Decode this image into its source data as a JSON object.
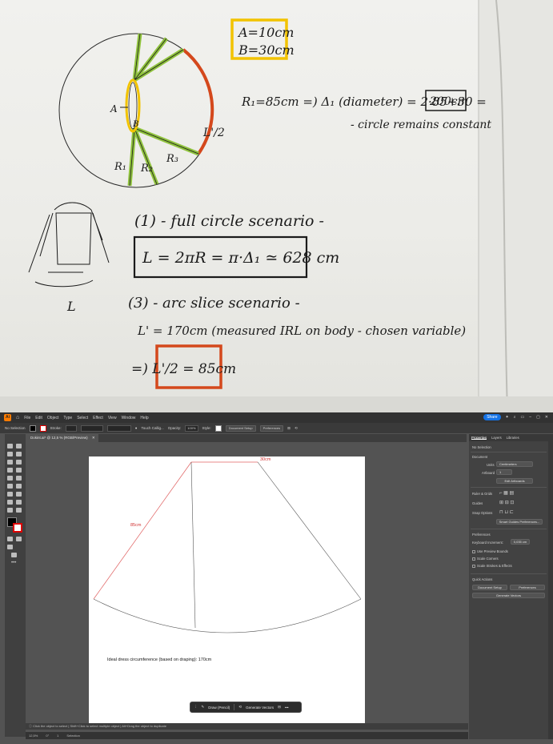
{
  "whiteboard": {
    "a_label": "A=10cm",
    "b_label": "B=30cm",
    "diagram_labels": {
      "a": "A",
      "b": "B",
      "r1": "R₁",
      "r2": "R₂",
      "r3": "R₃",
      "l_prime_half": "L'/2"
    },
    "line1": "R₁=85cm =) Δ₁ (diameter) = 2·85+30 = ",
    "boxed_value": "200cm",
    "line2": "- circle remains constant",
    "sketch_label": "L",
    "scenario1_title": "(1) - full circle scenario -",
    "scenario1_formula": "L = 2πR = π·Δ₁ ≃ 628 cm",
    "scenario3_title": "(3) - arc slice scenario -",
    "scenario3_line": "L' = 170cm (measured IRL on body - chosen variable)",
    "scenario3_result": "=) L'/2 = 85cm",
    "colors": {
      "yellow": "#f2c300",
      "green": "#8fc23d",
      "orange": "#d4481c"
    }
  },
  "app": {
    "menu": [
      "File",
      "Edit",
      "Object",
      "Type",
      "Select",
      "Effect",
      "View",
      "Window",
      "Help"
    ],
    "share": "Share",
    "control": {
      "selection": "No Selection",
      "stroke_label": "Stroke:",
      "brush": "Touch Callig...",
      "opacity_label": "Opacity:",
      "opacity_value": "100%",
      "style_label": "Style:",
      "document_setup": "Document Setup",
      "preferences": "Preferences"
    },
    "doc_tab": "Dokint.ai* @ 12,5 % (RGB/Preview)",
    "artboard": {
      "label_top": "30cm",
      "label_side": "85cm",
      "ideal_text": "Ideal dress circumference (based on draping): 170cm"
    },
    "float_bar": {
      "draw": "Draw (Pencil)",
      "generate": "Generate Vectors"
    },
    "status_hint": "Click the object to select | Shift+Click to select multiple object | Alt+Drag the object to duplicate",
    "bottom": {
      "zoom": "12,5%",
      "angle": "0°",
      "page": "1",
      "tool": "Selection"
    },
    "panel": {
      "tabs": [
        "Properties",
        "Layers",
        "Libraries"
      ],
      "no_selection": "No Selection",
      "document_heading": "Document",
      "units_label": "Units",
      "units_value": "Centimeters",
      "artboard_label": "Artboard",
      "artboard_value": "1",
      "edit_artboards": "Edit Artboards",
      "ruler_grids": "Ruler & Grids",
      "guides": "Guides",
      "snap_options": "Snap Options",
      "smart_guides": "Smart Guides Preferences...",
      "preferences_heading": "Preferences",
      "keyboard_increment_label": "Keyboard Increment:",
      "keyboard_increment_value": "0,035 cm",
      "use_preview_bounds": "Use Preview Bounds",
      "scale_corners": "Scale Corners",
      "scale_strokes": "Scale Strokes & Effects",
      "quick_actions": "Quick Actions",
      "document_setup": "Document Setup",
      "preferences": "Preferences",
      "generate_vectors": "Generate Vectors"
    }
  }
}
